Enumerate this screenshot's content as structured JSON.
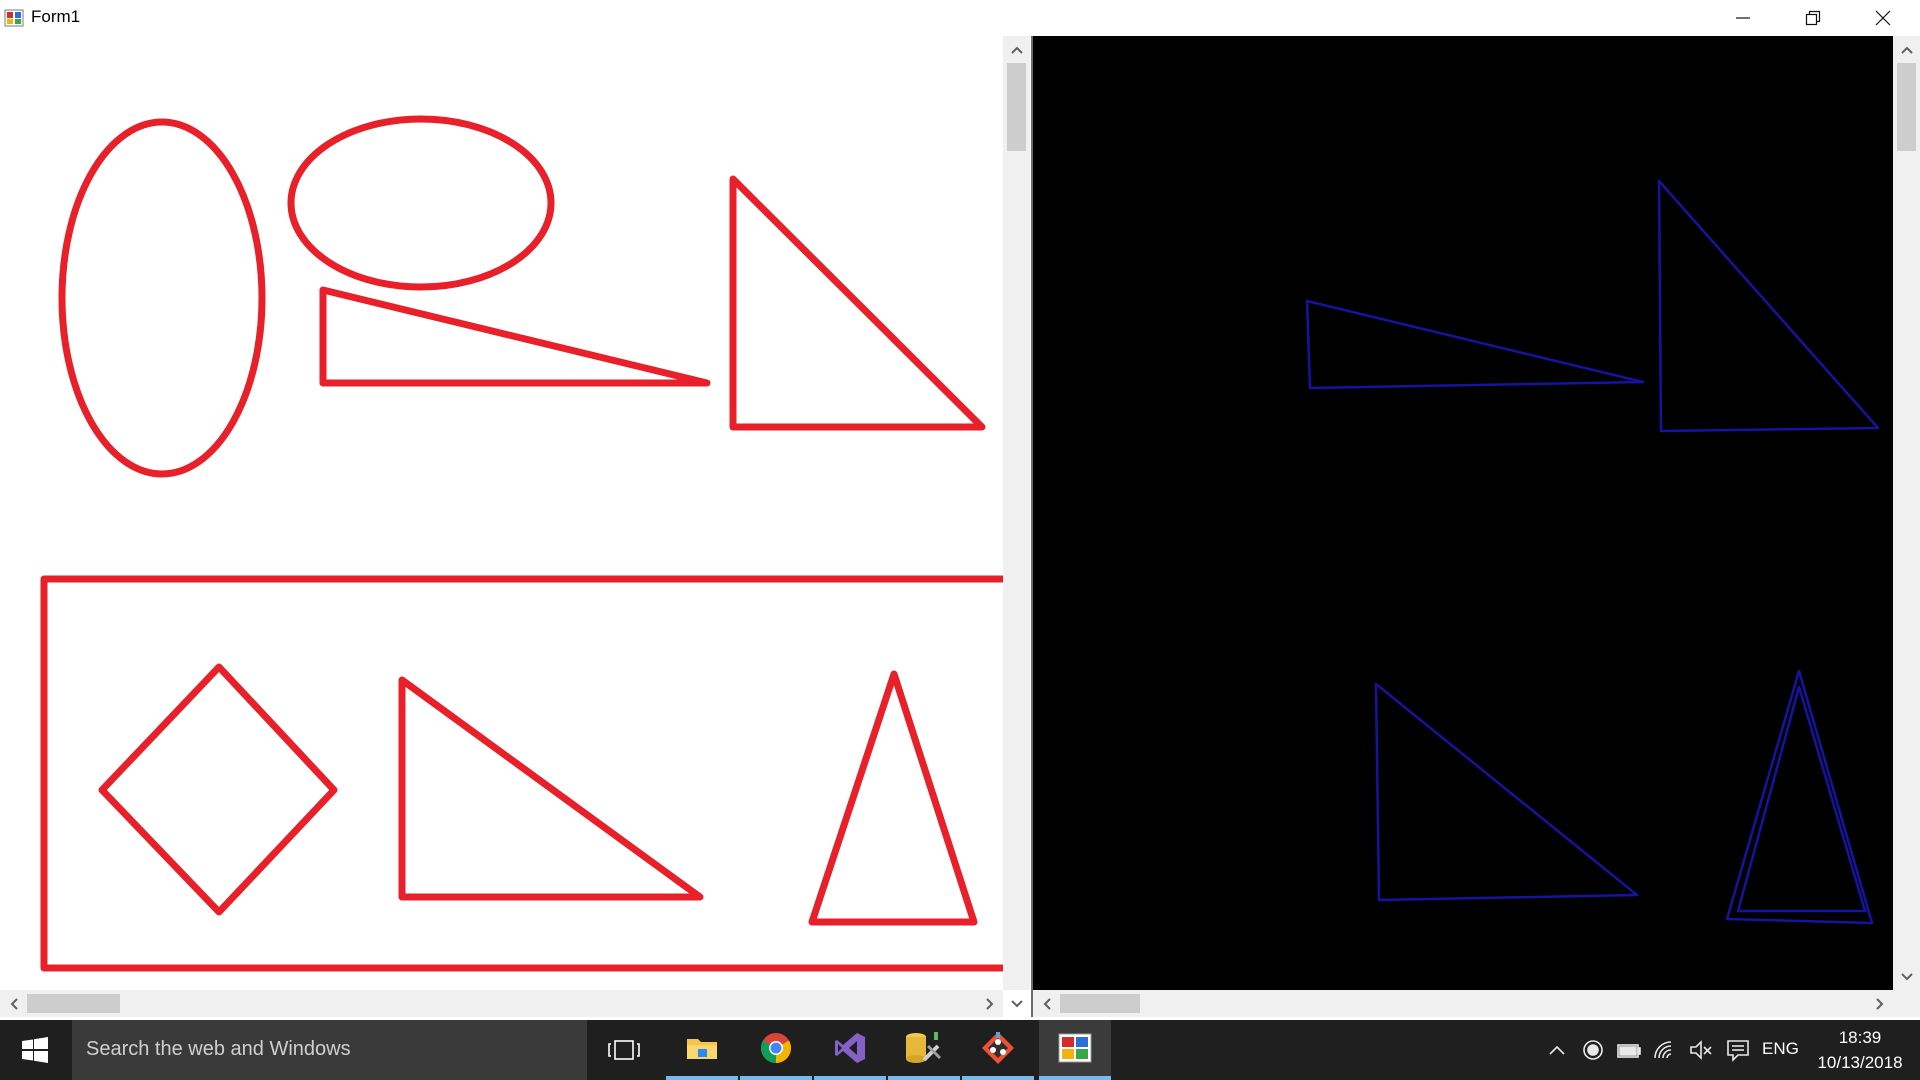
{
  "window": {
    "title": "Form1",
    "minimize_icon": "minimize-icon",
    "restore_icon": "restore-icon",
    "close_icon": "close-icon"
  },
  "left_canvas": {
    "background": "#ffffff",
    "shape_color": "#e8202a",
    "shapes": [
      "tall-ellipse",
      "wide-ellipse",
      "thin-triangle",
      "right-triangle",
      "frame-rectangle",
      "diamond",
      "right-triangle-bottom",
      "isosceles-triangle"
    ]
  },
  "right_canvas": {
    "background": "#000000",
    "shape_color": "#1414a0",
    "shapes": [
      "thin-triangle",
      "right-triangle",
      "right-triangle-bottom",
      "isosceles-triangle"
    ]
  },
  "taskbar": {
    "search_placeholder": "Search the web and Windows",
    "language": "ENG",
    "time": "18:39",
    "date": "10/13/2018",
    "pinned": [
      "task-view-icon",
      "file-explorer-icon",
      "chrome-icon",
      "visual-studio-icon",
      "database-tools-icon",
      "git-icon",
      "form-app-icon"
    ],
    "tray_icons": [
      "chevron-up-icon",
      "record-icon",
      "battery-icon",
      "wifi-icon",
      "volume-muted-icon",
      "notifications-icon"
    ],
    "accent": "#76b9ed"
  }
}
